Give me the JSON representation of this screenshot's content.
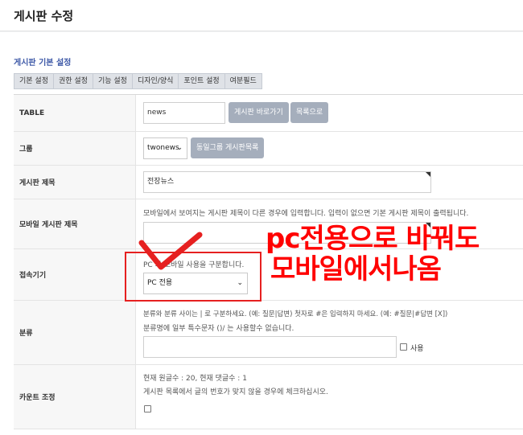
{
  "page": {
    "title": "게시판 수정"
  },
  "section": {
    "title": "게시판 기본 설정"
  },
  "tabs": [
    "기본 설정",
    "권한 설정",
    "기능 설정",
    "디자인/양식",
    "포인트 설정",
    "여분필드"
  ],
  "rows": {
    "table": {
      "label": "TABLE",
      "value": "news",
      "btn_goto": "게시판 바로가기",
      "btn_list": "목록으로"
    },
    "group": {
      "label": "그룹",
      "selected": "twonews",
      "btn_same_group": "동일그룹 게시판목록"
    },
    "subject": {
      "label": "게시판 제목",
      "value": "전장뉴스"
    },
    "mobile_subject": {
      "label": "모바일 게시판 제목",
      "help": "모바일에서 보여지는 게시판 제목이 다른 경우에 입력합니다. 입력이 없으면 기본 게시판 제목이 출력됩니다.",
      "value": ""
    },
    "device": {
      "label": "접속기기",
      "help": "PC 와 모바일 사용을 구분합니다.",
      "selected": "PC 전용"
    },
    "category": {
      "label": "분류",
      "help1": "분류와 분류 사이는 | 로 구분하세요. (예: 질문|답변) 첫자로 #은 입력하지 마세요. (예: #질문|#답변 [X])",
      "help2": "분류명에 일부 특수문자 ()/ 는 사용할수 없습니다.",
      "value": "",
      "use_label": "사용"
    },
    "count": {
      "label": "카운트 조정",
      "help1": "현재 원글수 : 20, 현재 댓글수 : 1",
      "help2": "게시판 목록에서 글의 번호가 맞지 않을 경우에 체크하십시오."
    }
  },
  "annotation": {
    "line1": "pc전용으로 바꿔도",
    "line2": "모바일에서나옴",
    "color": "#ff0000"
  },
  "colors": {
    "accent": "#3f5aa8",
    "button": "#a5aebc"
  }
}
